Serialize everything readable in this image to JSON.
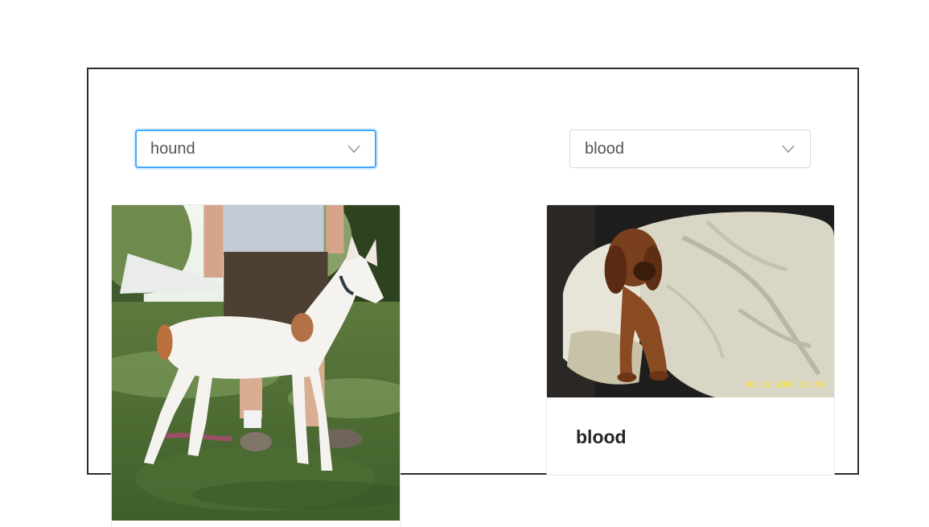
{
  "selectors": {
    "left": {
      "value": "hound"
    },
    "right": {
      "value": "blood"
    }
  },
  "cards": {
    "left": {
      "title": ""
    },
    "right": {
      "title": "blood",
      "photo_timestamp": "03 12 2002   21:39"
    }
  },
  "colors": {
    "focus_border": "#40a9ff",
    "frame_border": "#2b2b2b",
    "timestamp": "#ffe600"
  },
  "icons": {
    "dropdown": "chevron-down-icon"
  }
}
